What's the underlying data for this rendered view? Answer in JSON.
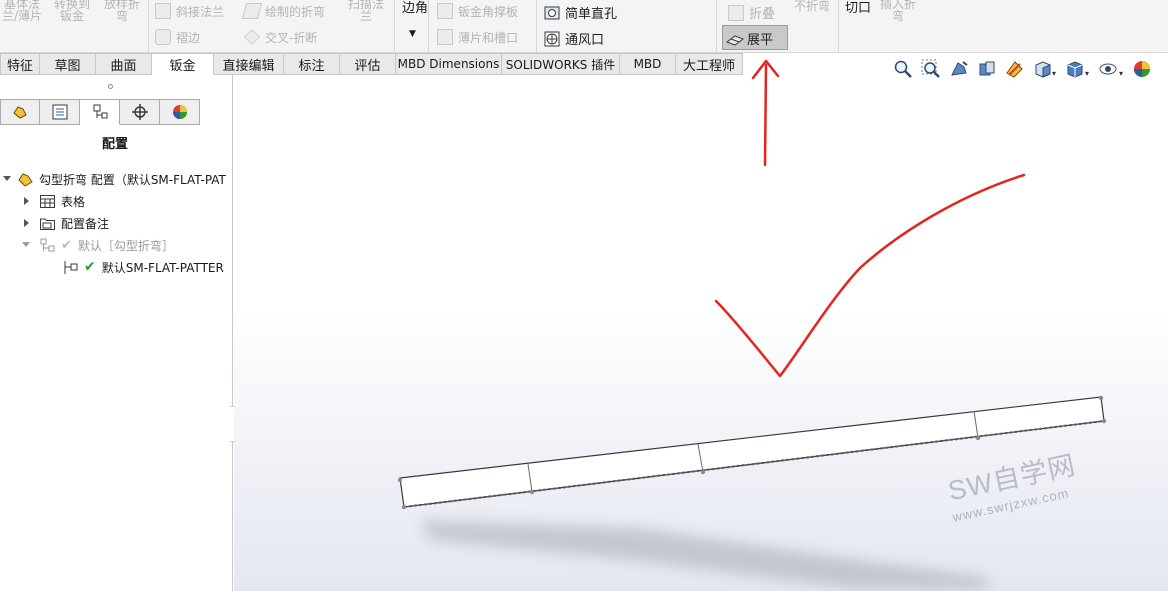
{
  "ribbon": {
    "col1": [
      "基体法",
      "兰/薄片"
    ],
    "col2": [
      "转换到",
      "钣金"
    ],
    "col3": [
      "放样折",
      "弯"
    ],
    "miter_flange": "斜接法兰",
    "hem": "褶边",
    "sketched_bend": "绘制的折弯",
    "cross_break": "交叉-折断",
    "swept_flange": [
      "扫描法",
      "兰"
    ],
    "edge_label": "边角",
    "corner_gusset": "钣金角撑板",
    "tab_slot": "薄片和槽口",
    "simple_hole": "简单直孔",
    "vent": "通风口",
    "fold": "折叠",
    "unbend": "不折弯",
    "unfold": "展平",
    "cut": "切口",
    "insert_bends": [
      "插入折",
      "弯"
    ]
  },
  "tabs": [
    {
      "label": "特征"
    },
    {
      "label": "草图"
    },
    {
      "label": "曲面"
    },
    {
      "label": "钣金"
    },
    {
      "label": "直接编辑"
    },
    {
      "label": "标注"
    },
    {
      "label": "评估"
    },
    {
      "label": "MBD Dimensions"
    },
    {
      "label": "SOLIDWORKS 插件"
    },
    {
      "label": "MBD"
    },
    {
      "label": "大工程师"
    }
  ],
  "panel": {
    "title": "配置",
    "tree": {
      "root": "勾型折弯 配置（默认SM-FLAT-PAT",
      "tables": "表格",
      "notes": "配置备注",
      "default": "默认［勾型折弯］",
      "flat_config": "默认SM-FLAT-PATTER"
    }
  },
  "watermark": {
    "main": "SW自学网",
    "sub": "www.swrjzxw.com"
  },
  "colors": {
    "annotation_red": "#e3261c",
    "active_tab": "#ffffff",
    "check_green": "#2f9a2f"
  }
}
